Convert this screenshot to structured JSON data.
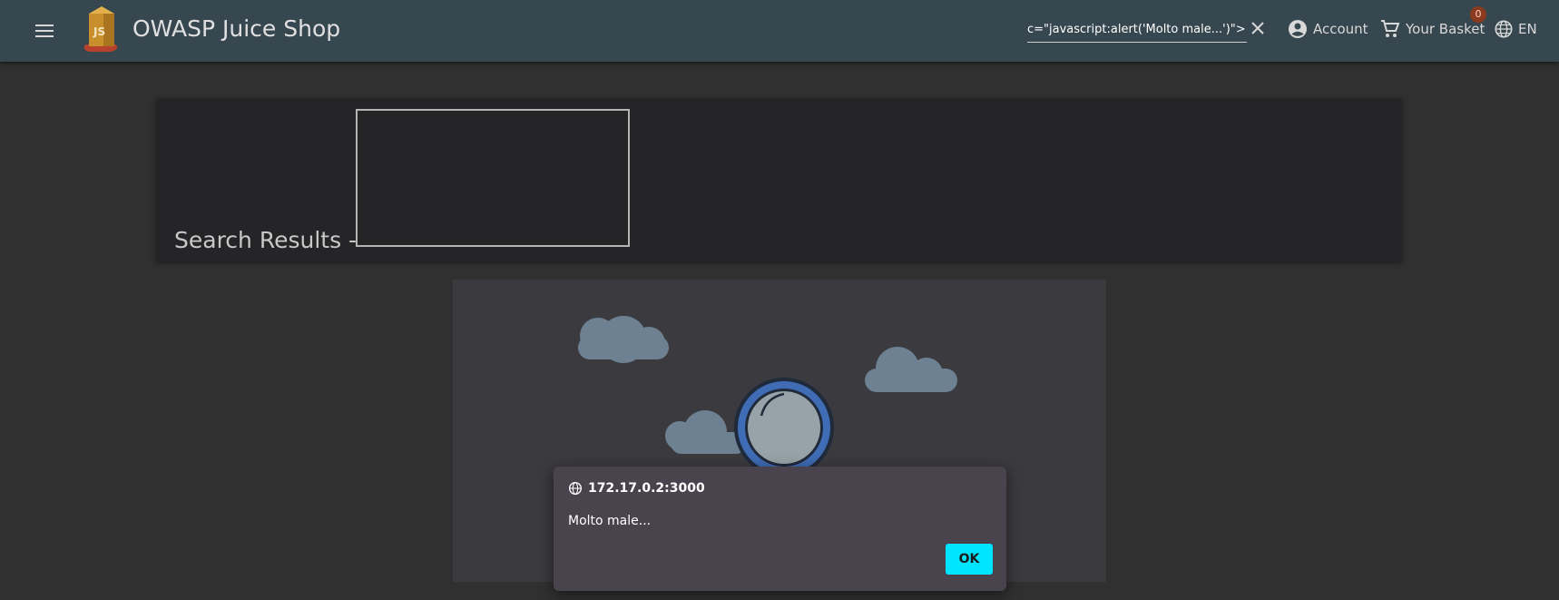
{
  "toolbar": {
    "app_title": "OWASP Juice Shop",
    "logo_text": "JS",
    "search_value": "c=\"javascript:alert('Molto male...')\">",
    "account_label": "Account",
    "basket_label": "Your Basket",
    "basket_count": "0",
    "language_label": "EN"
  },
  "results": {
    "heading": "Search Results -"
  },
  "dialog": {
    "origin": "172.17.0.2:3000",
    "message": "Molto male...",
    "ok_label": "OK"
  },
  "colors": {
    "toolbar": "#37474f",
    "background": "#303030",
    "dialog": "#48434d",
    "accent": "#00e5ff",
    "badge": "#8a3a1f",
    "cloud": "#6e8193",
    "magnifier_ring": "#3f6cb5"
  }
}
